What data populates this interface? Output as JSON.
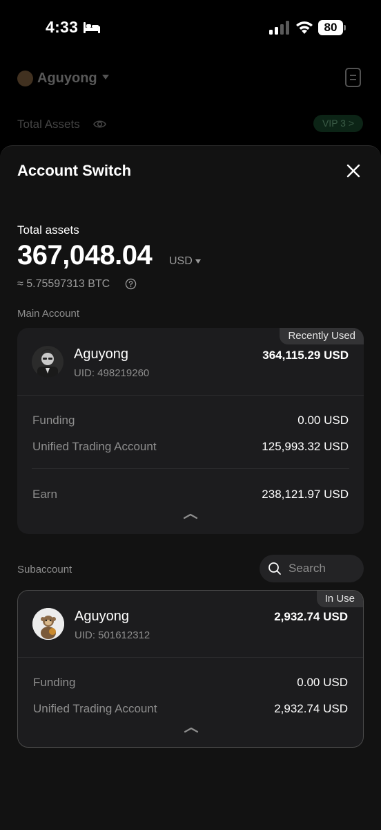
{
  "status_bar": {
    "time": "4:33",
    "battery": "80"
  },
  "background": {
    "account_name": "Aguyong",
    "total_assets_label": "Total Assets",
    "vip_label": "VIP 3 >"
  },
  "sheet": {
    "title": "Account Switch",
    "total_label": "Total assets",
    "total_value": "367,048.04",
    "currency": "USD",
    "btc_equivalent": "≈ 5.75597313 BTC"
  },
  "main_account": {
    "section_label": "Main Account",
    "badge": "Recently Used",
    "name": "Aguyong",
    "uid": "UID: 498219260",
    "amount": "364,115.29 USD",
    "rows": [
      {
        "label": "Funding",
        "value": "0.00 USD"
      },
      {
        "label": "Unified Trading Account",
        "value": "125,993.32 USD"
      },
      {
        "label": "Earn",
        "value": "238,121.97 USD"
      }
    ]
  },
  "subaccount": {
    "section_label": "Subaccount",
    "search_placeholder": "Search",
    "badge": "In Use",
    "name": "Aguyong",
    "uid": "UID: 501612312",
    "amount": "2,932.74 USD",
    "rows": [
      {
        "label": "Funding",
        "value": "0.00 USD"
      },
      {
        "label": "Unified Trading Account",
        "value": "2,932.74 USD"
      }
    ]
  },
  "colors": {
    "background": "#000000",
    "sheet": "#121212",
    "card": "#1c1c1e",
    "muted_text": "#8e8e8e",
    "vip_green": "#1f5a38"
  },
  "icons": [
    "bed-icon",
    "signal-icon",
    "wifi-icon",
    "document-icon",
    "eye-icon",
    "close-icon",
    "help-icon",
    "search-icon",
    "chevron-up-icon"
  ]
}
